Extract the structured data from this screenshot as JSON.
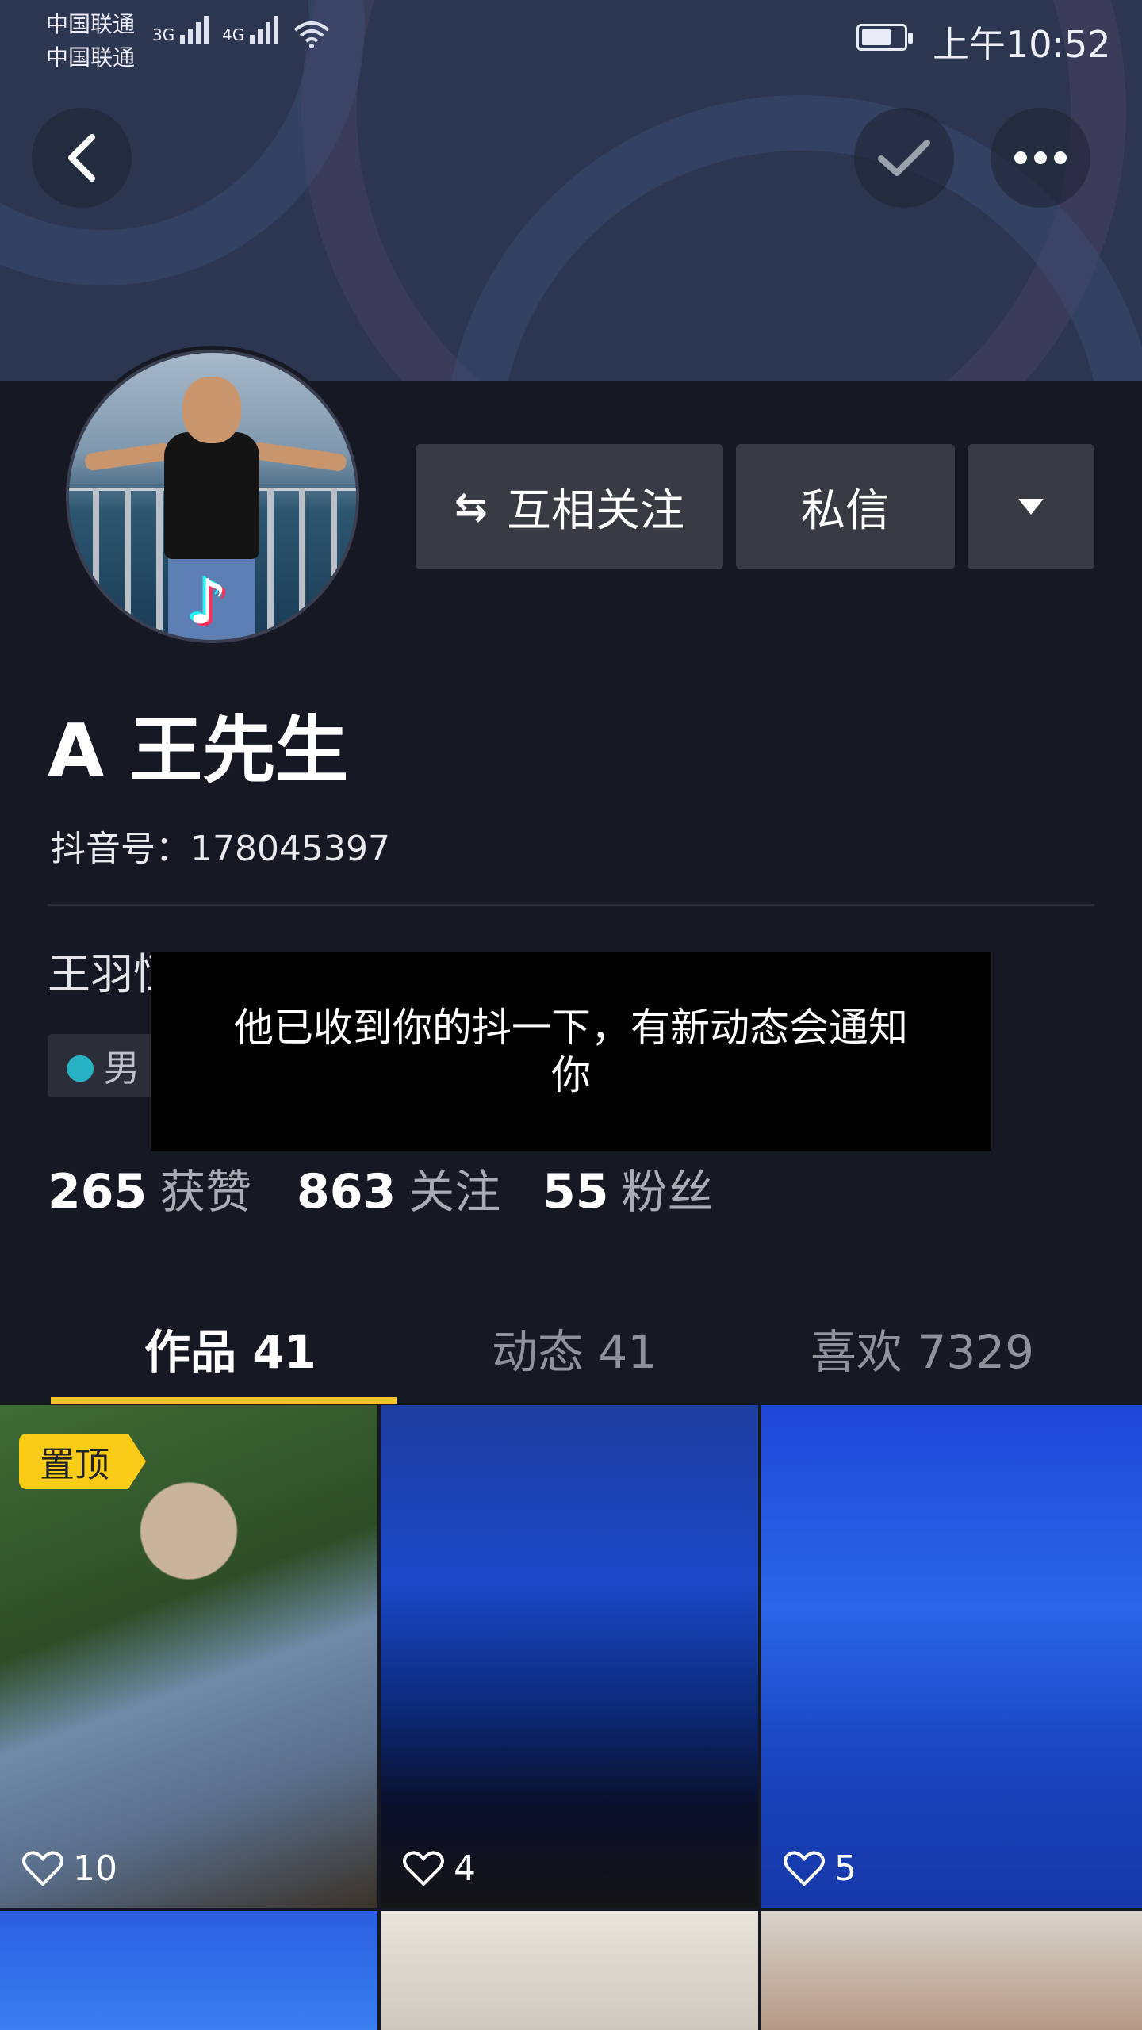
{
  "status_bar": {
    "carrier_1": "中国联通",
    "carrier_2": "中国联通",
    "network_1": "3G",
    "network_2": "4G",
    "time": "上午10:52"
  },
  "header": {
    "back_icon": "chevron-left-icon",
    "check_icon": "check-icon",
    "more_icon": "more-dots-icon"
  },
  "actions": {
    "follow_label": "互相关注",
    "message_label": "私信",
    "dropdown_icon": "caret-down-icon"
  },
  "profile": {
    "name": "A 王先生",
    "douyin_id": "抖音号：178045397",
    "bio": "王羽恒他爹",
    "gender": "男"
  },
  "stats": [
    {
      "value": "265",
      "label": "获赞"
    },
    {
      "value": "863",
      "label": "关注"
    },
    {
      "value": "55",
      "label": "粉丝"
    }
  ],
  "toast": {
    "line1": "他已收到你的抖一下，有新动态会通知",
    "line2": "你"
  },
  "tabs": [
    {
      "label": "作品 41",
      "active": true
    },
    {
      "label": "动态 41",
      "active": false
    },
    {
      "label": "喜欢 7329",
      "active": false
    }
  ],
  "videos": [
    {
      "likes": "10",
      "pinned_label": "置顶"
    },
    {
      "likes": "4"
    },
    {
      "likes": "5"
    }
  ],
  "colors": {
    "background": "#161823",
    "accent": "#f8c22a",
    "button": "#393b44"
  }
}
